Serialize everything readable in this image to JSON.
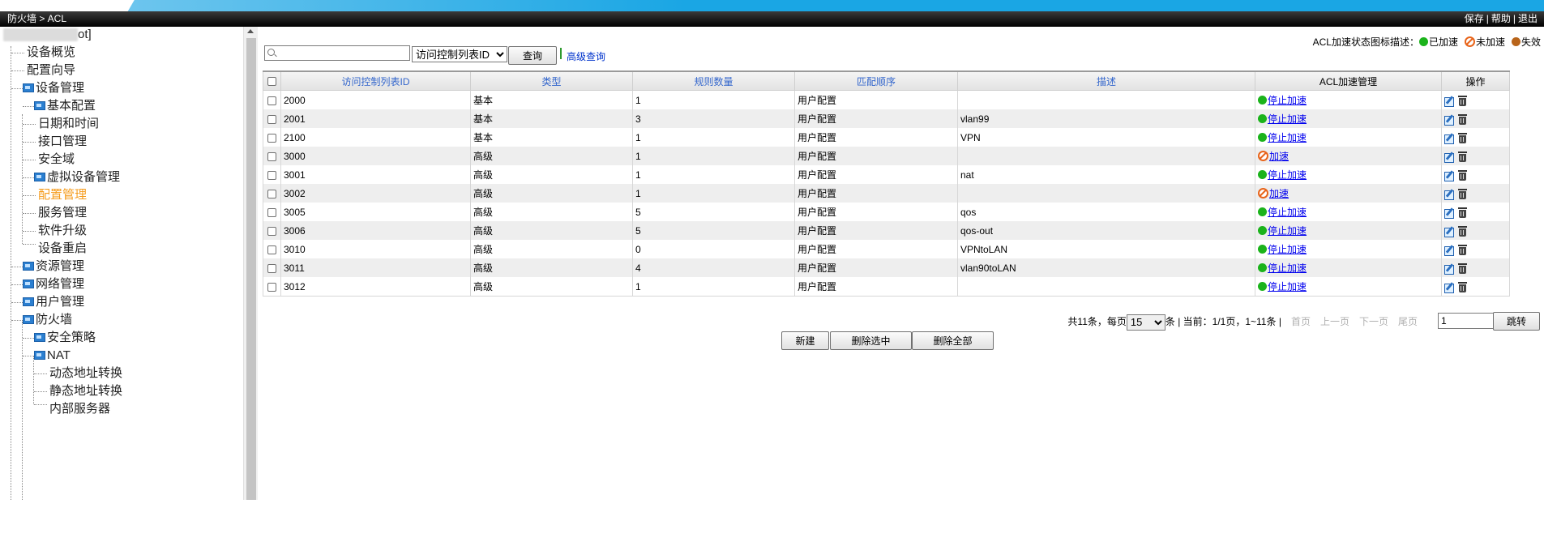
{
  "titlebar": {
    "breadcrumb": "防火墙 > ACL",
    "save": "保存",
    "help": "帮助",
    "logout": "退出",
    "separator": "|"
  },
  "sidebar": {
    "root_suffix": "ot]",
    "items": [
      {
        "label": "设备概览"
      },
      {
        "label": "配置向导"
      },
      {
        "label": "设备管理"
      },
      {
        "label": "基本配置"
      },
      {
        "label": "日期和时间"
      },
      {
        "label": "接口管理"
      },
      {
        "label": "安全域"
      },
      {
        "label": "虚拟设备管理"
      },
      {
        "label": "配置管理"
      },
      {
        "label": "服务管理"
      },
      {
        "label": "软件升级"
      },
      {
        "label": "设备重启"
      },
      {
        "label": "资源管理"
      },
      {
        "label": "网络管理"
      },
      {
        "label": "用户管理"
      },
      {
        "label": "防火墙"
      },
      {
        "label": "安全策略"
      },
      {
        "label": "NAT"
      },
      {
        "label": "动态地址转换"
      },
      {
        "label": "静态地址转换"
      },
      {
        "label": "内部服务器"
      }
    ]
  },
  "search": {
    "value": "",
    "field_selected": "访问控制列表ID",
    "query_label": "查询",
    "advanced_label": "高级查询"
  },
  "legend": {
    "title": "ACL加速状态图标描述：",
    "accelerated": "已加速",
    "not_accelerated": "未加速",
    "failed": "失效",
    "colors": {
      "accelerated": "#1bb31b",
      "not_accelerated": "#f07a22",
      "failed": "#b8641a"
    }
  },
  "table": {
    "headers": {
      "id": "访问控制列表ID",
      "type": "类型",
      "rule_count": "规则数量",
      "match_order": "匹配顺序",
      "description": "描述",
      "accel_mgmt": "ACL加速管理",
      "ops": "操作"
    },
    "rows": [
      {
        "id": "2000",
        "type": "基本",
        "rules": "1",
        "order": "用户配置",
        "desc": "",
        "accel": "停止加速"
      },
      {
        "id": "2001",
        "type": "基本",
        "rules": "3",
        "order": "用户配置",
        "desc": "vlan99",
        "accel": "停止加速"
      },
      {
        "id": "2100",
        "type": "基本",
        "rules": "1",
        "order": "用户配置",
        "desc": "VPN",
        "accel": "停止加速"
      },
      {
        "id": "3000",
        "type": "高级",
        "rules": "1",
        "order": "用户配置",
        "desc": "",
        "accel": "加速"
      },
      {
        "id": "3001",
        "type": "高级",
        "rules": "1",
        "order": "用户配置",
        "desc": "nat",
        "accel": "停止加速"
      },
      {
        "id": "3002",
        "type": "高级",
        "rules": "1",
        "order": "用户配置",
        "desc": "",
        "accel": "加速"
      },
      {
        "id": "3005",
        "type": "高级",
        "rules": "5",
        "order": "用户配置",
        "desc": "qos",
        "accel": "停止加速"
      },
      {
        "id": "3006",
        "type": "高级",
        "rules": "5",
        "order": "用户配置",
        "desc": "qos-out",
        "accel": "停止加速"
      },
      {
        "id": "3010",
        "type": "高级",
        "rules": "0",
        "order": "用户配置",
        "desc": "VPNtoLAN",
        "accel": "停止加速"
      },
      {
        "id": "3011",
        "type": "高级",
        "rules": "4",
        "order": "用户配置",
        "desc": "vlan90toLAN",
        "accel": "停止加速"
      },
      {
        "id": "3012",
        "type": "高级",
        "rules": "1",
        "order": "用户配置",
        "desc": "",
        "accel": "停止加速"
      }
    ]
  },
  "pager": {
    "total_prefix": "共11条，每页",
    "page_size": "15",
    "total_suffix": "条 | 当前：1/1页，1~11条 |",
    "first": "首页",
    "prev": "上一页",
    "next": "下一页",
    "last": "尾页",
    "page_input": "1",
    "go_label": "跳转"
  },
  "actions": {
    "new_label": "新建",
    "delete_selected_label": "删除选中",
    "delete_all_label": "删除全部"
  }
}
